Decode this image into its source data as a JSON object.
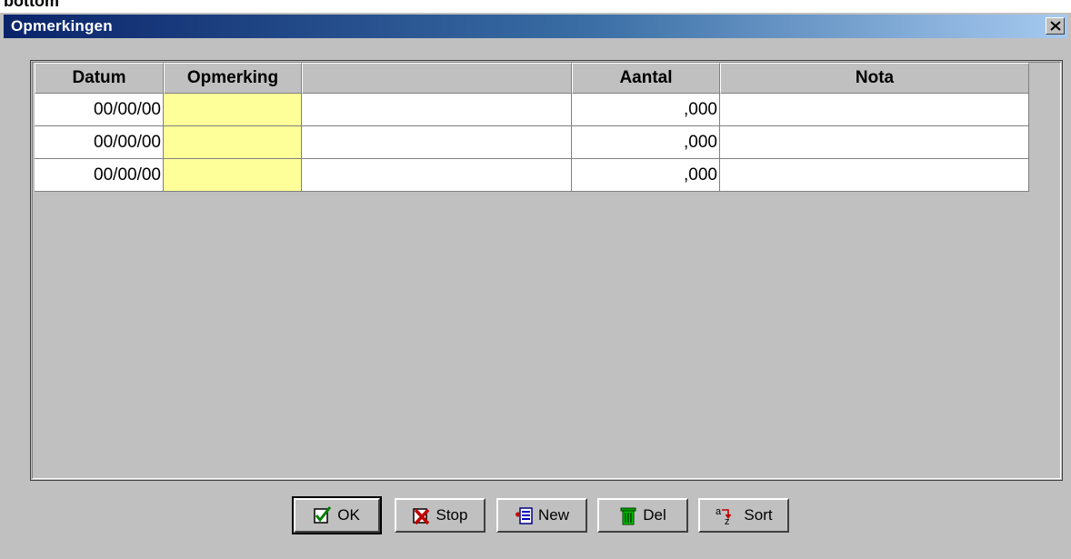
{
  "top_strip_text": "bottom",
  "window": {
    "title": "Opmerkingen"
  },
  "grid": {
    "columns": [
      "Datum",
      "Opmerking",
      "",
      "Aantal",
      "Nota"
    ],
    "rows": [
      {
        "datum": "00/00/00",
        "opmerking": "",
        "omschrijving": "",
        "aantal": ",000",
        "nota": ""
      },
      {
        "datum": "00/00/00",
        "opmerking": "",
        "omschrijving": "",
        "aantal": ",000",
        "nota": ""
      },
      {
        "datum": "00/00/00",
        "opmerking": "",
        "omschrijving": "",
        "aantal": ",000",
        "nota": ""
      }
    ]
  },
  "buttons": {
    "ok": "OK",
    "stop": "Stop",
    "new": "New",
    "del": "Del",
    "sort": "Sort",
    "sort_icon_a": "a",
    "sort_icon_z": "z"
  },
  "colors": {
    "titlebar_start": "#0a246a",
    "titlebar_end": "#a6caf0",
    "highlight_cell": "#ffff99",
    "face": "#c0c0c0"
  },
  "icons": {
    "ok": "checkmark-icon",
    "stop": "cross-icon",
    "new": "new-record-icon",
    "del": "trash-icon",
    "sort": "sort-az-icon",
    "close": "close-icon"
  }
}
